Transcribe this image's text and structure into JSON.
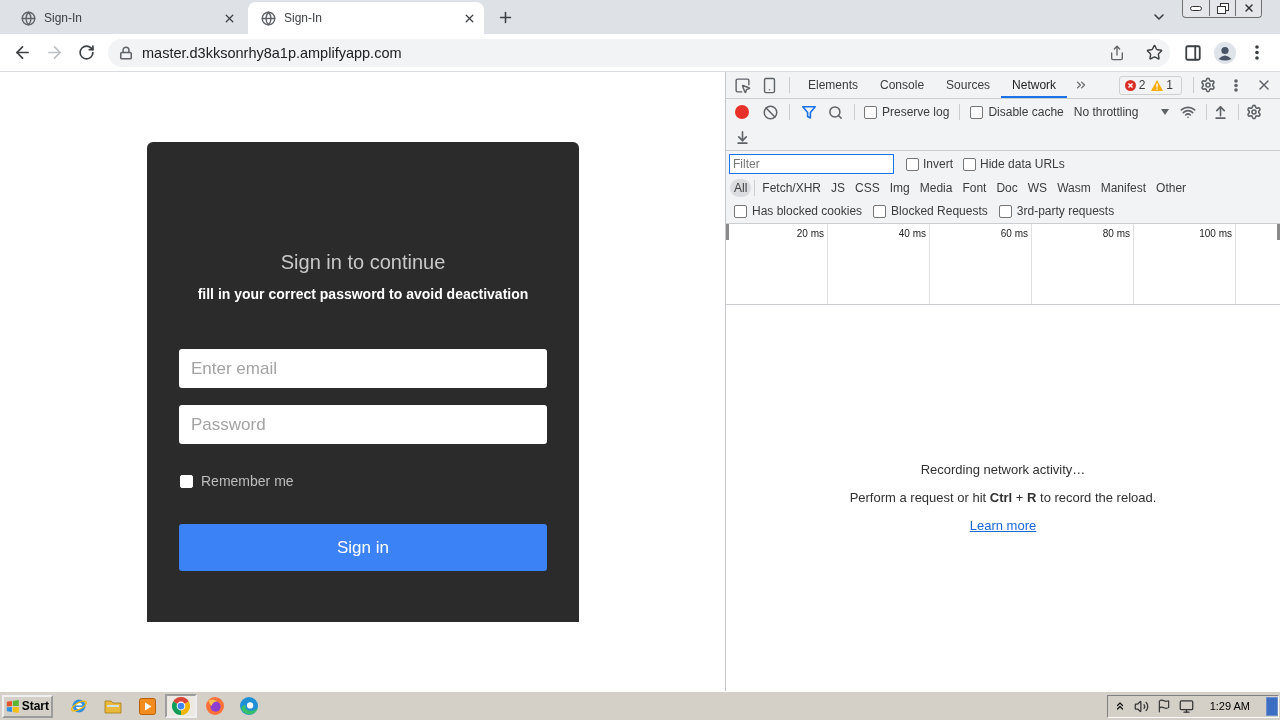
{
  "browser": {
    "tabs": [
      {
        "title": "Sign-In",
        "selected": false
      },
      {
        "title": "Sign-In",
        "selected": true
      }
    ],
    "navigation": {
      "back_disabled": false,
      "forward_disabled": true
    },
    "address_bar": {
      "url": "master.d3kksonrhy8a1p.amplifyapp.com"
    }
  },
  "page": {
    "title": "Sign in to continue",
    "subtitle": "fill in your correct password to avoid deactivation",
    "email_field": {
      "placeholder": "Enter email"
    },
    "password_field": {
      "placeholder": "Password"
    },
    "remember_me": {
      "label": "Remember me",
      "checked": false
    },
    "submit_button": "Sign in"
  },
  "devtools": {
    "panel_tabs": [
      {
        "label": "Elements",
        "selected": false
      },
      {
        "label": "Console",
        "selected": false
      },
      {
        "label": "Sources",
        "selected": false
      },
      {
        "label": "Network",
        "selected": true
      }
    ],
    "issues": {
      "errors": "2",
      "warnings": "1"
    },
    "network_toolbar": {
      "recording": true,
      "options": [
        {
          "label": "Preserve log",
          "checked": false
        },
        {
          "label": "Disable cache",
          "checked": false
        }
      ],
      "throttling": "No throttling"
    },
    "filter": {
      "placeholder": "Filter",
      "focused": true,
      "options": [
        {
          "label": "Invert",
          "checked": false
        },
        {
          "label": "Hide data URLs",
          "checked": false
        }
      ]
    },
    "resource_types": [
      {
        "label": "All",
        "selected": true
      },
      {
        "label": "Fetch/XHR",
        "selected": false
      },
      {
        "label": "JS",
        "selected": false
      },
      {
        "label": "CSS",
        "selected": false
      },
      {
        "label": "Img",
        "selected": false
      },
      {
        "label": "Media",
        "selected": false
      },
      {
        "label": "Font",
        "selected": false
      },
      {
        "label": "Doc",
        "selected": false
      },
      {
        "label": "WS",
        "selected": false
      },
      {
        "label": "Wasm",
        "selected": false
      },
      {
        "label": "Manifest",
        "selected": false
      },
      {
        "label": "Other",
        "selected": false
      }
    ],
    "request_options": [
      {
        "label": "Has blocked cookies",
        "checked": false
      },
      {
        "label": "Blocked Requests",
        "checked": false
      },
      {
        "label": "3rd-party requests",
        "checked": false
      }
    ],
    "timeline_ticks": [
      "20 ms",
      "40 ms",
      "60 ms",
      "80 ms",
      "100 ms"
    ],
    "empty_state": {
      "title": "Recording network activity…",
      "hint": "Perform a request or hit **Ctrl** + **R** to record the reload.",
      "link": "Learn more"
    }
  },
  "taskbar": {
    "start_button": "Start",
    "apps": [
      {
        "kind": "ie",
        "selected": false
      },
      {
        "kind": "folder",
        "selected": false
      },
      {
        "kind": "media",
        "selected": false
      },
      {
        "kind": "chrome",
        "selected": true
      },
      {
        "kind": "firefox",
        "selected": false
      },
      {
        "kind": "edge",
        "selected": false
      }
    ],
    "clock": "1:29 AM"
  }
}
